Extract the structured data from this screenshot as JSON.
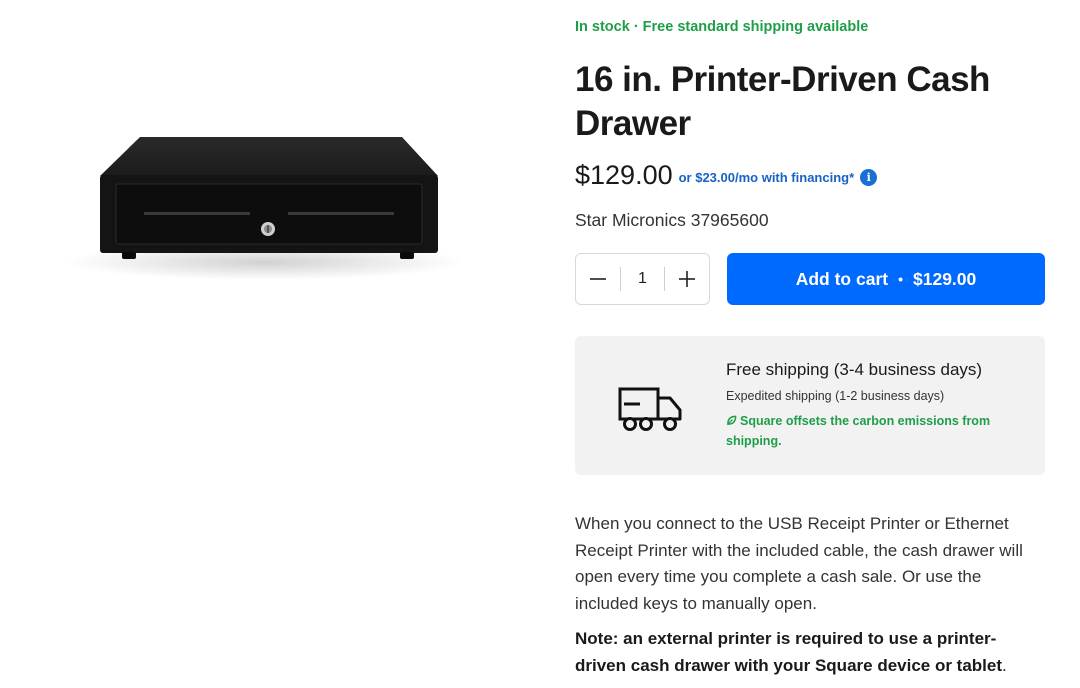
{
  "stock": {
    "text": "In stock · Free standard shipping available",
    "color": "#1f9e4a"
  },
  "product": {
    "title": "16 in. Printer-Driven Cash Drawer",
    "price": "$129.00",
    "financing": "or $23.00/mo with financing*",
    "sku": "Star Micronics 37965600",
    "image_alt": "cash-drawer-image"
  },
  "quantity": {
    "value": "1",
    "minus_icon": "minus-icon",
    "plus_icon": "plus-icon"
  },
  "cart": {
    "label": "Add to cart",
    "separator": "•",
    "price": "$129.00",
    "color": "#006aff"
  },
  "shipping": {
    "icon": "truck-icon",
    "title": "Free shipping (3-4 business days)",
    "expedited": "Expedited shipping (1-2 business days)",
    "carbon": "Square offsets the carbon emissions from shipping."
  },
  "description": "When you connect to the USB Receipt Printer or Ethernet Receipt Printer with the included cable, the cash drawer will open every time you complete a cash sale. Or use the included keys to manually open.",
  "note": {
    "bold": "Note: an external printer is required to use a printer-driven cash drawer with your Square device or tablet",
    "tail": "."
  }
}
